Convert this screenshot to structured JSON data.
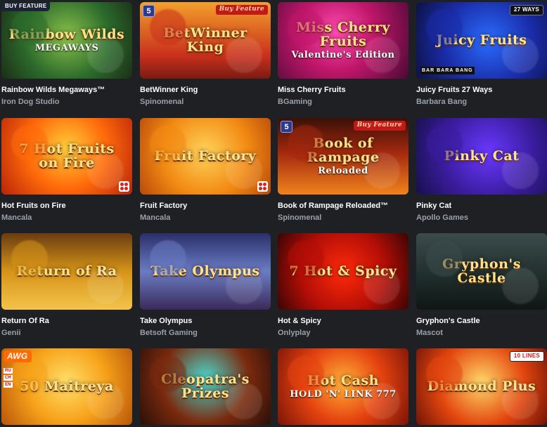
{
  "games": [
    {
      "title": "Rainbow Wilds Megaways™",
      "provider": "Iron Dog Studio",
      "logo": "Rainbow Wilds",
      "logo_sub": "MEGAWAYS",
      "badge": "BUY FEATURE",
      "badge_style": "b-dark",
      "color": "#2c6b2c",
      "five": false,
      "prov_icon": false,
      "bbb": false,
      "flags": false
    },
    {
      "title": "BetWinner King",
      "provider": "Spinomenal",
      "logo": "BetWinner King",
      "logo_sub": "",
      "badge": "Buy Feature",
      "badge_style": "b-red",
      "color": "#c9301c",
      "five": true,
      "prov_icon": false,
      "bbb": false,
      "flags": false
    },
    {
      "title": "Miss Cherry Fruits",
      "provider": "BGaming",
      "logo": "Miss Cherry Fruits",
      "logo_sub": "Valentine's Edition",
      "badge": "",
      "badge_style": "",
      "color": "#c0166a",
      "five": false,
      "prov_icon": false,
      "bbb": false,
      "flags": false
    },
    {
      "title": "Juicy Fruits 27 Ways",
      "provider": "Barbara Bang",
      "logo": "Juicy Fruits",
      "logo_sub": "",
      "badge": "27 WAYS",
      "badge_style": "b-black",
      "color": "#1a2ca8",
      "five": false,
      "prov_icon": false,
      "bbb": true,
      "flags": false
    },
    {
      "title": "Hot Fruits on Fire",
      "provider": "Mancala",
      "logo": "7 Hot Fruits on Fire",
      "logo_sub": "",
      "badge": "",
      "badge_style": "",
      "color": "#ff6a0a",
      "five": false,
      "prov_icon": true,
      "bbb": false,
      "flags": false
    },
    {
      "title": "Fruit Factory",
      "provider": "Mancala",
      "logo": "Fruit Factory",
      "logo_sub": "",
      "badge": "",
      "badge_style": "",
      "color": "#f28a13",
      "five": false,
      "prov_icon": true,
      "bbb": false,
      "flags": false
    },
    {
      "title": "Book of Rampage Reloaded™",
      "provider": "Spinomenal",
      "logo": "Book of Rampage",
      "logo_sub": "Reloaded",
      "badge": "Buy Feature",
      "badge_style": "b-red",
      "color": "#a3280e",
      "five": true,
      "prov_icon": false,
      "bbb": false,
      "flags": false
    },
    {
      "title": "Pinky Cat",
      "provider": "Apollo Games",
      "logo": "Pinky Cat",
      "logo_sub": "",
      "badge": "",
      "badge_style": "",
      "color": "#3a1c9e",
      "five": false,
      "prov_icon": false,
      "bbb": false,
      "flags": false
    },
    {
      "title": "Return Of Ra",
      "provider": "Genii",
      "logo": "Return of Ra",
      "logo_sub": "",
      "badge": "",
      "badge_style": "",
      "color": "#d69418",
      "five": false,
      "prov_icon": false,
      "bbb": false,
      "flags": false
    },
    {
      "title": "Take Olympus",
      "provider": "Betsoft Gaming",
      "logo": "Take Olympus",
      "logo_sub": "",
      "badge": "",
      "badge_style": "",
      "color": "#6b7cc4",
      "five": false,
      "prov_icon": false,
      "bbb": false,
      "flags": false
    },
    {
      "title": "Hot & Spicy",
      "provider": "Onlyplay",
      "logo": "7 Hot & Spicy",
      "logo_sub": "",
      "badge": "",
      "badge_style": "",
      "color": "#b30e07",
      "five": false,
      "prov_icon": false,
      "bbb": false,
      "flags": false
    },
    {
      "title": "Gryphon's Castle",
      "provider": "Mascot",
      "logo": "Gryphon's Castle",
      "logo_sub": "",
      "badge": "",
      "badge_style": "",
      "color": "#3b4c4c",
      "five": false,
      "prov_icon": false,
      "bbb": false,
      "flags": false
    },
    {
      "title": "",
      "provider": "",
      "logo": "50 Maitreya",
      "logo_sub": "",
      "badge": "AWG",
      "badge_style": "b-orange",
      "color": "#f7a21a",
      "five": false,
      "prov_icon": false,
      "bbb": false,
      "flags": true
    },
    {
      "title": "",
      "provider": "",
      "logo": "Cleopatra's Prizes",
      "logo_sub": "",
      "badge": "",
      "badge_style": "",
      "color": "#7a2a0e",
      "five": false,
      "prov_icon": false,
      "bbb": false,
      "flags": false
    },
    {
      "title": "",
      "provider": "",
      "logo": "Hot Cash",
      "logo_sub": "HOLD 'N' LINK 777",
      "badge": "",
      "badge_style": "",
      "color": "#e5430f",
      "five": false,
      "prov_icon": false,
      "bbb": false,
      "flags": false
    },
    {
      "title": "",
      "provider": "",
      "logo": "Diamond Plus",
      "logo_sub": "",
      "badge": "10 LINES",
      "badge_style": "b-white",
      "color": "#e3460e",
      "five": false,
      "prov_icon": false,
      "bbb": false,
      "flags": false
    }
  ],
  "flag_labels": [
    "RU",
    "CH",
    "EN"
  ],
  "bbb_label": "BAR BARA BANG",
  "five_label": "5"
}
